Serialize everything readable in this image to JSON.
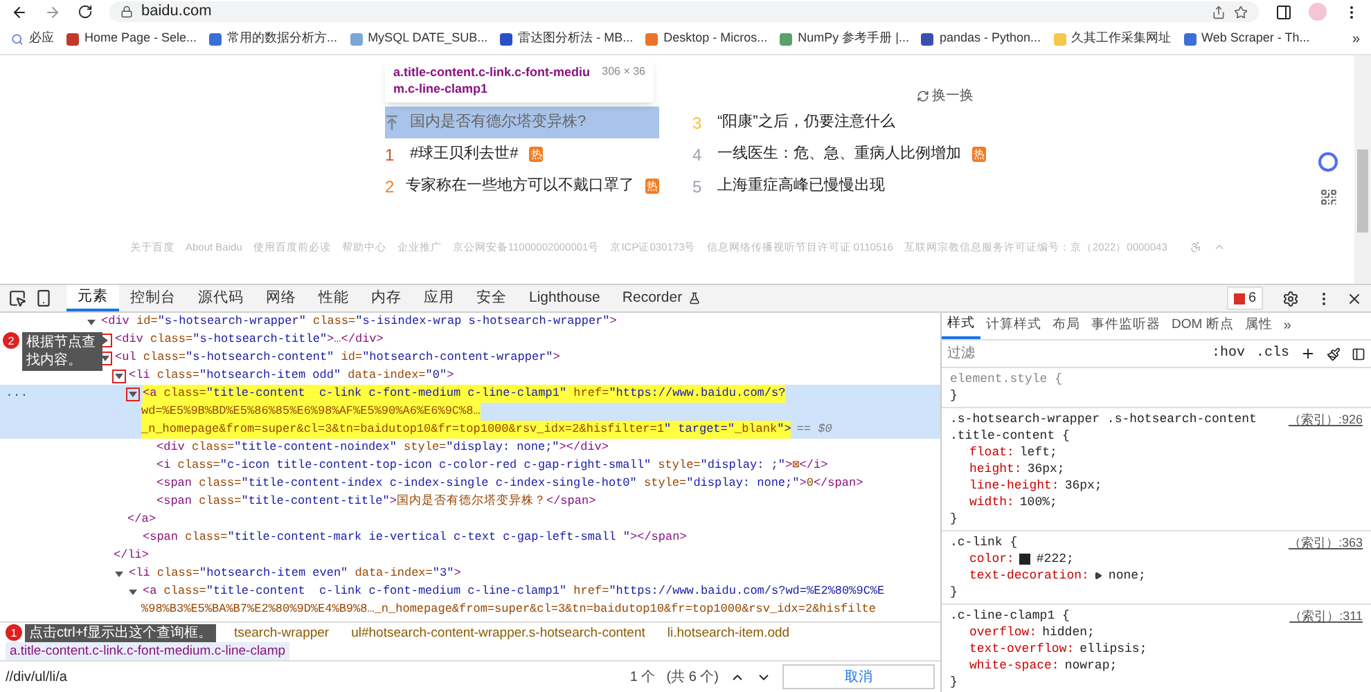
{
  "browser": {
    "url": "baidu.com",
    "bookmarks": [
      {
        "label": "必应",
        "color": "#4a6fd8"
      },
      {
        "label": "Home Page - Sele...",
        "color": "#c0392b"
      },
      {
        "label": "常用的数据分析方...",
        "color": "#3b6fd6"
      },
      {
        "label": "MySQL DATE_SUB...",
        "color": "#7aa7d8"
      },
      {
        "label": "雷达图分析法 - MB...",
        "color": "#2850c8"
      },
      {
        "label": "Desktop - Micros...",
        "color": "#e8742a"
      },
      {
        "label": "NumPy 参考手册 |...",
        "color": "#5aa06a"
      },
      {
        "label": "pandas - Python...",
        "color": "#3a4fb0"
      },
      {
        "label": "久其工作采集网址",
        "color": "#f2c94c"
      },
      {
        "label": "Web Scraper - Th...",
        "color": "#3b6fd6"
      }
    ],
    "bookmarks_more": "»"
  },
  "page": {
    "inspect_tooltip": {
      "selector": "a.title-content.c-link.c-font-medium.c-line-clamp1",
      "size": "306 × 36"
    },
    "refresh_label": "换一换",
    "hot_items": [
      {
        "kind": "pinned",
        "title": "国内是否有德尔塔变异株?",
        "selected": true,
        "color": "#7d8790"
      },
      {
        "kind": "ranked",
        "rank": "1",
        "title": "#球王贝利去世#",
        "badge": "热",
        "selected": false,
        "color": "#e0492f"
      },
      {
        "kind": "ranked",
        "rank": "2",
        "title": "专家称在一些地方可以不戴口罩了",
        "badge": "热",
        "selected": false,
        "color": "#f27c23"
      },
      {
        "kind": "ranked",
        "rank": "3",
        "title": "“阳康”之后，仍要注意什么",
        "selected": false,
        "color": "#f5c22e"
      },
      {
        "kind": "ranked",
        "rank": "4",
        "title": "一线医生：危、急、重病人比例增加",
        "badge": "热",
        "selected": false,
        "color": "#9aa3ad"
      },
      {
        "kind": "ranked",
        "rank": "5",
        "title": "上海重症高峰已慢慢出现",
        "selected": false,
        "color": "#9aa3ad"
      }
    ],
    "footer_links": [
      "关于百度",
      "About Baidu",
      "使用百度前必读",
      "帮助中心",
      "企业推广",
      "京公网安备11000002000001号",
      "京ICP证030173号",
      "信息网络传播视听节目许可证 0110516",
      "互联网宗教信息服务许可证编号：京（2022）0000043"
    ]
  },
  "devtools": {
    "tabs": [
      {
        "label": "元素",
        "selected": true
      },
      {
        "label": "控制台",
        "selected": false
      },
      {
        "label": "源代码",
        "selected": false
      },
      {
        "label": "网络",
        "selected": false
      },
      {
        "label": "性能",
        "selected": false
      },
      {
        "label": "内存",
        "selected": false
      },
      {
        "label": "应用",
        "selected": false
      },
      {
        "label": "安全",
        "selected": false
      },
      {
        "label": "Lighthouse",
        "selected": false
      },
      {
        "label": "Recorder",
        "selected": false
      }
    ],
    "error_count": "6",
    "gutter_marker": "...",
    "callouts": [
      {
        "number": "2",
        "text": "根据节点查找内容。"
      },
      {
        "number": "1",
        "text": "点击ctrl+f显示出这个查询框。"
      }
    ],
    "dom_tree": [
      {
        "kind": "parent",
        "expanded": true,
        "selected": false,
        "annotated": false,
        "lines": [
          "<div id=\"s-hotsearch-wrapper\" class=\"s-isindex-wrap s-hotsearch-wrapper\">"
        ],
        "children": [
          {
            "kind": "parent",
            "expanded": false,
            "selected": false,
            "annotated": true,
            "lines": [
              "<div class=\"s-hotsearch-title\">…</div>"
            ]
          },
          {
            "kind": "parent",
            "expanded": true,
            "selected": false,
            "annotated": true,
            "lines": [
              "<ul class=\"s-hotsearch-content\" id=\"hotsearch-content-wrapper\">"
            ],
            "children": [
              {
                "kind": "parent",
                "expanded": true,
                "selected": false,
                "annotated": true,
                "lines": [
                  "<li class=\"hotsearch-item odd\" data-index=\"0\">"
                ],
                "close": "</li>",
                "children": [
                  {
                    "kind": "parent",
                    "expanded": true,
                    "selected": true,
                    "annotated": true,
                    "marker": "== $0",
                    "close": "</a>",
                    "lines": [
                      "<a class=\"title-content  c-link c-font-medium c-line-clamp1\" href=\"https://www.baidu.com/s?",
                      "wd=%E5%9B%BD%E5%86%85%E6%98%AF%E5%90%A6%E6%9C%8…",
                      "_n_homepage&from=super&cl=3&tn=baidutop10&fr=top1000&rsv_idx=2&hisfilter=1\" target=\"_blank\">"
                    ],
                    "children": [
                      {
                        "kind": "leaf",
                        "selected": false,
                        "lines": [
                          "<div class=\"title-content-noindex\" style=\"display: none;\"></div>"
                        ]
                      },
                      {
                        "kind": "leaf",
                        "selected": false,
                        "lines": [
                          "<i class=\"c-icon title-content-top-icon c-color-red c-gap-right-small\" style=\"display: ;\">⊠</i>"
                        ]
                      },
                      {
                        "kind": "leaf",
                        "selected": false,
                        "lines": [
                          "<span class=\"title-content-index c-index-single c-index-single-hot0\" style=\"display: none;\">0</span>"
                        ]
                      },
                      {
                        "kind": "leaf",
                        "selected": false,
                        "lines": [
                          "<span class=\"title-content-title\">国内是否有德尔塔变异株？</span>"
                        ]
                      }
                    ]
                  },
                  {
                    "kind": "leaf",
                    "selected": false,
                    "lines": [
                      "<span class=\"title-content-mark ie-vertical c-text c-gap-left-small \"></span>"
                    ]
                  }
                ]
              },
              {
                "kind": "parent",
                "expanded": true,
                "selected": false,
                "annotated": false,
                "lines": [
                  "<li class=\"hotsearch-item even\" data-index=\"3\">"
                ],
                "children": [
                  {
                    "kind": "parent",
                    "expanded": true,
                    "selected": false,
                    "annotated": false,
                    "lines": [
                      "<a class=\"title-content  c-link c-font-medium c-line-clamp1\" href=\"https://www.baidu.com/s?wd=%E2%80%9C%E",
                      "%98%B3%E5%BA%B7%E2%80%9D%E4%B9%8…_n_homepage&from=super&cl=3&tn=baidutop10&fr=top1000&rsv_idx=2&hisfilte"
                    ]
                  }
                ]
              }
            ]
          }
        ]
      }
    ],
    "breadcrumbs": [
      {
        "label": "tsearch-wrapper",
        "selected": false
      },
      {
        "label": "ul#hotsearch-content-wrapper.s-hotsearch-content",
        "selected": false
      },
      {
        "label": "li.hotsearch-item.odd",
        "selected": false
      },
      {
        "label": "a.title-content.c-link.c-font-medium.c-line-clamp",
        "selected": true
      }
    ],
    "search": {
      "value": "//div/ul/li/a",
      "result": "1 个",
      "total": "(共 6 个)",
      "cancel": "取消"
    },
    "styles": {
      "tabs": [
        {
          "label": "样式",
          "selected": true
        },
        {
          "label": "计算样式",
          "selected": false
        },
        {
          "label": "布局",
          "selected": false
        },
        {
          "label": "事件监听器",
          "selected": false
        },
        {
          "label": "DOM 断点",
          "selected": false
        },
        {
          "label": "属性",
          "selected": false
        }
      ],
      "tabs_more": "»",
      "filter": {
        "placeholder": "过滤"
      },
      "hov": ":hov",
      "cls": ".cls",
      "rules": [
        {
          "selector": [
            "element.style {"
          ],
          "close": "}"
        },
        {
          "selector": [
            ".s-hotsearch-wrapper .s-hotsearch-content",
            ".title-content {"
          ],
          "source": "（索引）:926",
          "props": [
            {
              "name": "float:",
              "value": "left;"
            },
            {
              "name": "height:",
              "value": "36px;"
            },
            {
              "name": "line-height:",
              "value": "36px;"
            },
            {
              "name": "width:",
              "value": "100%;"
            }
          ],
          "close": "}"
        },
        {
          "selector": [
            ".c-link {"
          ],
          "source": "（索引）:363",
          "props": [
            {
              "name": "color:",
              "value": "#222;",
              "color": "#222222"
            },
            {
              "name": "text-decoration:",
              "value": "none;",
              "expandable": true
            }
          ],
          "close": "}"
        },
        {
          "selector": [
            ".c-line-clamp1 {"
          ],
          "source": "（索引）:311",
          "props": [
            {
              "name": "overflow:",
              "value": "hidden;"
            },
            {
              "name": "text-overflow:",
              "value": "ellipsis;"
            },
            {
              "name": "white-space:",
              "value": "nowrap;"
            }
          ],
          "close": "}"
        }
      ]
    }
  }
}
